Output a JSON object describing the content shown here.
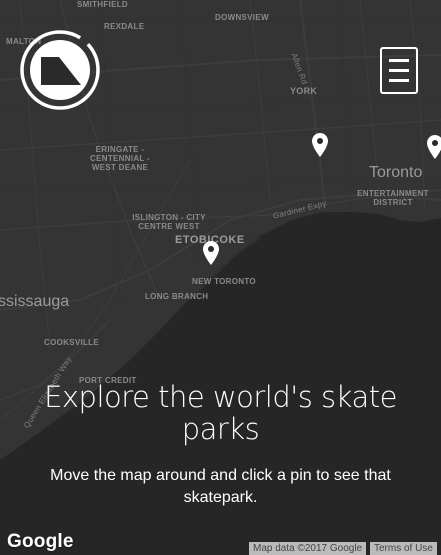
{
  "map": {
    "labels": {
      "smithfield": "SMITHFIELD",
      "rexdale": "REXDALE",
      "downsview": "DOWNSVIEW",
      "malton": "MALTON",
      "allen_rd": "Allen Rd",
      "york": "YORK",
      "toronto": "Toronto",
      "entertainment_district": "ENTERTAINMENT DISTRICT",
      "eringate": "ERINGATE - CENTENNIAL - WEST DEANE",
      "islington": "ISLINGTON - CITY CENTRE WEST",
      "gardiner_expy": "Gardiner Expy",
      "etobicoke": "ETOBICOKE",
      "new_toronto": "NEW TORONTO",
      "long_branch": "LONG BRANCH",
      "mississauga": "ssissauga",
      "cooksville": "COOKSVILLE",
      "port_credit": "PORT CREDIT",
      "queen_elizabeth_way": "Queen Elizabeth Way"
    },
    "pin_count": 3
  },
  "header": {
    "logo_alt": "skatepark-logo",
    "menu_icon": "hamburger-menu-icon"
  },
  "hero": {
    "title": "Explore the world's skate parks",
    "subtitle": "Move the map around and click a pin to see that skatepark."
  },
  "map_footer": {
    "google": "Google",
    "map_data": "Map data ©2017 Google",
    "terms": "Terms of Use"
  },
  "colors": {
    "map_background": "#2a2a2a",
    "water": "#262626",
    "land": "#343434",
    "roads": "#3e3e3e",
    "text_light": "#ffffff",
    "label_gray": "#8a8a8a"
  }
}
